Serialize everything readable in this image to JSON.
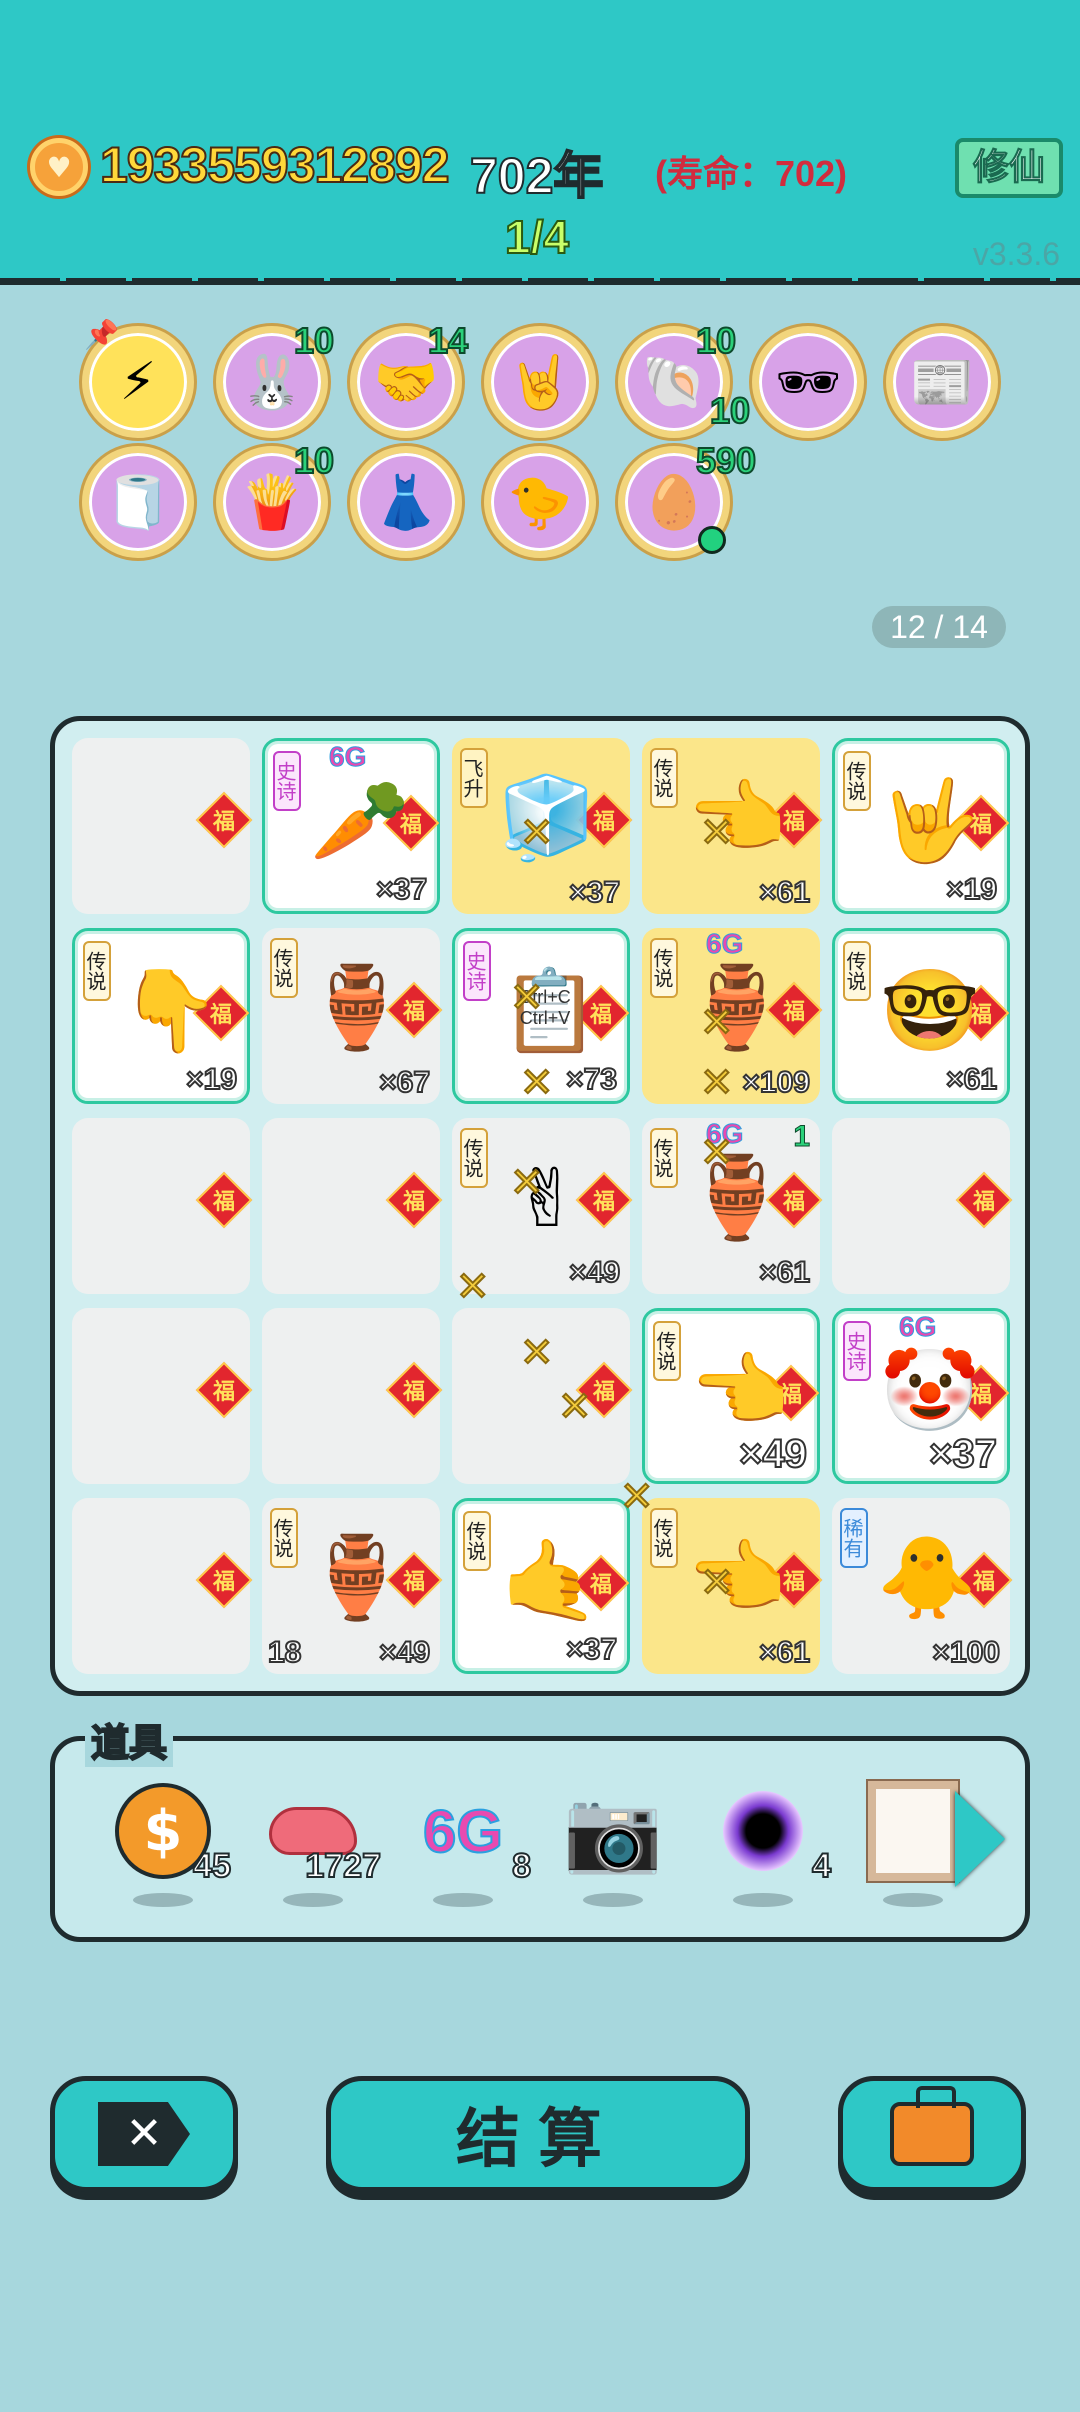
{
  "header": {
    "coin_value": "1933559312892",
    "year_value": "702年",
    "lifespan": "(寿命：702)",
    "cultivate_label": "修仙",
    "progress": "1/4",
    "version": "v3.3.6"
  },
  "buffs": {
    "row1": [
      {
        "icon": "lightning-icon",
        "count": ""
      },
      {
        "icon": "rabbit-icon",
        "count": "10"
      },
      {
        "icon": "handshake-icon",
        "count": "14"
      },
      {
        "icon": "rock-hand-icon",
        "count": ""
      },
      {
        "icon": "shell-icon",
        "count": "10"
      },
      {
        "icon": "sunglasses-egg-icon",
        "count": ""
      },
      {
        "icon": "time-magazine-icon",
        "count": ""
      }
    ],
    "row2": [
      {
        "icon": "tissue-box-icon",
        "count": ""
      },
      {
        "icon": "fries-icon",
        "count": "10"
      },
      {
        "icon": "skirt-icon",
        "count": ""
      },
      {
        "icon": "chick-icon",
        "count": ""
      },
      {
        "icon": "egg-tray-icon",
        "count": "590",
        "extra": "10"
      }
    ],
    "round_counter": "12 / 14"
  },
  "board": {
    "fu_char": "福",
    "tags": {
      "legend": "传说",
      "epic": "史诗",
      "rare": "稀有",
      "ascend": "飞升"
    },
    "g6": "6G",
    "cells": [
      {
        "mult": ""
      },
      {
        "tag": "epic",
        "mult": "×37",
        "art": "🥕",
        "g6": true
      },
      {
        "tag": "ascend",
        "mult": "×37",
        "art": "🧊"
      },
      {
        "tag": "legend",
        "mult": "×61",
        "art": "👈"
      },
      {
        "tag": "legend",
        "mult": "×19",
        "art": "🤟"
      },
      {
        "tag": "legend",
        "mult": "×19",
        "art": "👇"
      },
      {
        "tag": "legend",
        "mult": "×67",
        "art": "🏺"
      },
      {
        "tag": "epic",
        "mult": "×73",
        "art": "📋",
        "copy_text": "Ctrl+C Ctrl+V"
      },
      {
        "tag": "legend",
        "mult": "×109",
        "art": "🏺",
        "g6": true
      },
      {
        "tag": "legend",
        "mult": "×61",
        "art": "🤓"
      },
      {
        "mult": ""
      },
      {
        "mult": ""
      },
      {
        "tag": "legend",
        "mult": "×49",
        "art": "✌"
      },
      {
        "tag": "legend",
        "mult": "×61",
        "art": "🏺",
        "g6": true,
        "corner": "1"
      },
      {
        "mult": ""
      },
      {
        "mult": ""
      },
      {
        "mult": ""
      },
      {
        "mult": ""
      },
      {
        "tag": "legend",
        "mult": "×49",
        "art": "👈"
      },
      {
        "tag": "epic",
        "mult": "×37",
        "art": "🤡",
        "g6": true
      },
      {
        "mult": ""
      },
      {
        "tag": "legend",
        "mult": "×49",
        "art": "🏺",
        "corner_left": "18"
      },
      {
        "tag": "legend",
        "mult": "×37",
        "art": "🤙"
      },
      {
        "tag": "legend",
        "mult": "×61",
        "art": "👈"
      },
      {
        "tag": "rare",
        "mult": "×100",
        "art": "🐥"
      }
    ]
  },
  "items": {
    "title": "道具",
    "list": [
      {
        "icon": "dollar-coin-icon",
        "count": "45"
      },
      {
        "icon": "liver-icon",
        "count": "1727"
      },
      {
        "icon": "6g-icon",
        "label": "6G",
        "count": "8"
      },
      {
        "icon": "camera-icon",
        "count": ""
      },
      {
        "icon": "black-hole-icon",
        "count": "4"
      },
      {
        "icon": "frame-icon",
        "count": ""
      }
    ]
  },
  "buttons": {
    "settle": "结算",
    "close_symbol": "✕"
  },
  "colors": {
    "header_bg": "#2ec8c6",
    "page_bg": "#a7d7dd",
    "gold": "#ffd83a",
    "red": "#d12c3e"
  }
}
